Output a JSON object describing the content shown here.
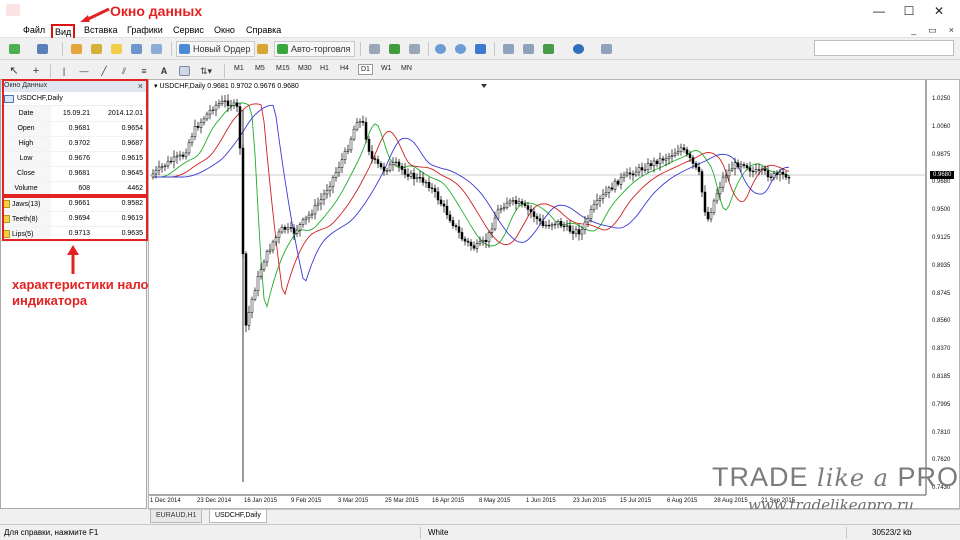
{
  "annotations": {
    "data_window_label": "Окно данных",
    "indicator_label_line1": "характеристики наложенного",
    "indicator_label_line2": "индикатора"
  },
  "window": {
    "minimize": "—",
    "maximize": "☐",
    "close": "✕"
  },
  "menu": [
    "Файл",
    "Вид",
    "Вставка",
    "Графики",
    "Сервис",
    "Окно",
    "Справка"
  ],
  "toolbar": {
    "new_order": "Новый Ордер",
    "autotrading": "Авто-торговля",
    "timeframes": [
      "M1",
      "M5",
      "M15",
      "M30",
      "H1",
      "H4",
      "D1",
      "W1",
      "MN"
    ],
    "active_timeframe": "D1",
    "text_tool": "A"
  },
  "data_window": {
    "title": "Окно Данных",
    "symbol": "USDCHF,Daily",
    "rows": [
      {
        "label": "Date",
        "v1": "15.09.21",
        "v2": "2014.12.01"
      },
      {
        "label": "Open",
        "v1": "0.9681",
        "v2": "0.9654"
      },
      {
        "label": "High",
        "v1": "0.9702",
        "v2": "0.9687"
      },
      {
        "label": "Low",
        "v1": "0.9676",
        "v2": "0.9615"
      },
      {
        "label": "Close",
        "v1": "0.9681",
        "v2": "0.9645"
      },
      {
        "label": "Volume",
        "v1": "608",
        "v2": "4462"
      }
    ],
    "indicators": [
      {
        "label": "Jaws(13)",
        "v1": "0.9661",
        "v2": "0.9582"
      },
      {
        "label": "Teeth(8)",
        "v1": "0.9694",
        "v2": "0.9619"
      },
      {
        "label": "Lips(5)",
        "v1": "0.9713",
        "v2": "0.9635"
      }
    ]
  },
  "chart": {
    "header": "USDCHF,Daily  0.9681 0.9702 0.9676 0.9680",
    "current_price": "0.9680",
    "price_ticks": [
      "1.0250",
      "1.0060",
      "0.9875",
      "0.9680",
      "0.9500",
      "0.9125",
      "0.8935",
      "0.8745",
      "0.8560",
      "0.8370",
      "0.8185",
      "0.7995",
      "0.7810",
      "0.7620",
      "0.7430"
    ],
    "date_ticks": [
      "1 Dec 2014",
      "23 Dec 2014",
      "16 Jan 2015",
      "9 Feb 2015",
      "3 Mar 2015",
      "25 Mar 2015",
      "16 Apr 2015",
      "8 May 2015",
      "1 Jun 2015",
      "23 Jun 2015",
      "15 Jul 2015",
      "6 Aug 2015",
      "28 Aug 2015",
      "21 Sep 2015"
    ],
    "colors": {
      "jaws": "#3a3ad8",
      "teeth": "#d02020",
      "lips": "#1fae2a",
      "candles": "#000000"
    }
  },
  "watermark": {
    "brand_trade": "TRADE",
    "brand_like": "like",
    "brand_a": "a",
    "brand_pro": "PRO",
    "url": "www.tradelikeapro.ru"
  },
  "tabs": [
    "EURAUD,H1",
    "USDCHF,Daily"
  ],
  "active_tab": "USDCHF,Daily",
  "status": {
    "help": "Для справки, нажмите F1",
    "profile": "White",
    "traffic": "30523/2 kb"
  }
}
